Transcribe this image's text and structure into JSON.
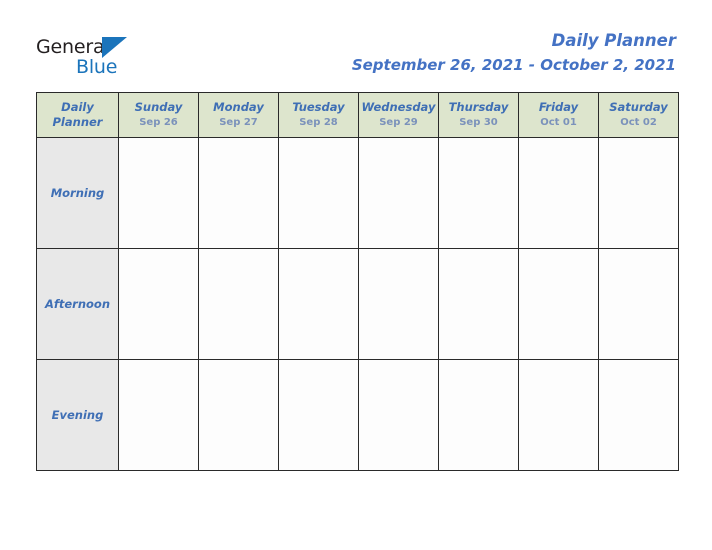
{
  "brand": {
    "name_part1": "General",
    "name_part2": "Blue",
    "triangle_icon": "triangle-icon",
    "color_dark": "#231f20",
    "color_blue": "#1b74bb"
  },
  "header": {
    "title": "Daily Planner",
    "date_range": "September 26, 2021 - October 2, 2021",
    "title_color": "#4472c4"
  },
  "table": {
    "corner": {
      "line1": "Daily",
      "line2": "Planner"
    },
    "header_bg": "#dde5cd",
    "label_bg": "#e8e8e8",
    "cell_bg": "#fdfdfd",
    "border_color": "#2a2a2a",
    "day_name_color": "#3f6fb5",
    "day_date_color": "#7b92bb",
    "columns": [
      {
        "day": "Sunday",
        "date": "Sep 26"
      },
      {
        "day": "Monday",
        "date": "Sep 27"
      },
      {
        "day": "Tuesday",
        "date": "Sep 28"
      },
      {
        "day": "Wednesday",
        "date": "Sep 29"
      },
      {
        "day": "Thursday",
        "date": "Sep 30"
      },
      {
        "day": "Friday",
        "date": "Oct 01"
      },
      {
        "day": "Saturday",
        "date": "Oct 02"
      }
    ],
    "rows": [
      {
        "label": "Morning",
        "entries": [
          "",
          "",
          "",
          "",
          "",
          "",
          ""
        ]
      },
      {
        "label": "Afternoon",
        "entries": [
          "",
          "",
          "",
          "",
          "",
          "",
          ""
        ]
      },
      {
        "label": "Evening",
        "entries": [
          "",
          "",
          "",
          "",
          "",
          "",
          ""
        ]
      }
    ]
  }
}
